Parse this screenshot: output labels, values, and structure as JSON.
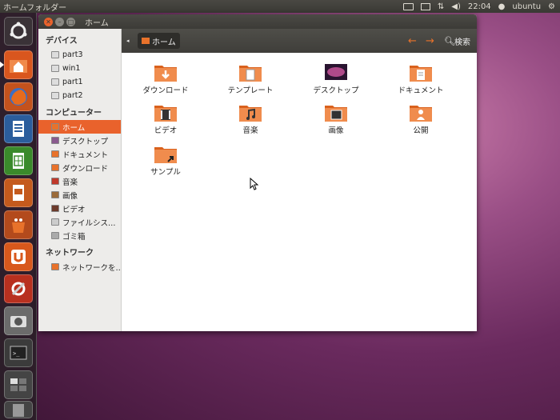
{
  "topbar": {
    "title": "ホームフォルダー",
    "time": "22:04",
    "user": "ubuntu"
  },
  "launcher": {
    "items": [
      "dash",
      "home-folder",
      "firefox",
      "writer",
      "calc",
      "impress",
      "software-center",
      "ubuntu-one",
      "system-settings",
      "screenshot",
      "terminal",
      "workspace-switcher",
      "trash"
    ]
  },
  "window": {
    "title": "ホーム"
  },
  "toolbar": {
    "crumb": "ホーム",
    "search": "検索"
  },
  "sidebar": {
    "devices_header": "デバイス",
    "devices": [
      "part3",
      "win1",
      "part1",
      "part2"
    ],
    "computer_header": "コンピューター",
    "computer": [
      "ホーム",
      "デスクトップ",
      "ドキュメント",
      "ダウンロード",
      "音楽",
      "画像",
      "ビデオ",
      "ファイルシス…",
      "ゴミ箱"
    ],
    "network_header": "ネットワーク",
    "network": [
      "ネットワークを…"
    ]
  },
  "files": [
    "ダウンロード",
    "テンプレート",
    "デスクトップ",
    "ドキュメント",
    "ビデオ",
    "音楽",
    "画像",
    "公開",
    "サンプル"
  ],
  "colors": {
    "accent": "#e9622c",
    "folder": "#e8722b",
    "titlebar": "#3c3b37"
  }
}
